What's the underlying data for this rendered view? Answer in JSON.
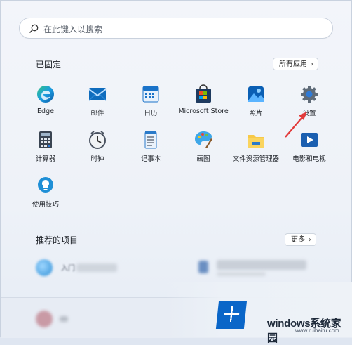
{
  "search": {
    "placeholder": "在此键入以搜索"
  },
  "pinned": {
    "title": "已固定",
    "all_apps_label": "所有应用",
    "apps": [
      {
        "label": "Edge",
        "icon": "edge-icon"
      },
      {
        "label": "邮件",
        "icon": "mail-icon"
      },
      {
        "label": "日历",
        "icon": "calendar-icon"
      },
      {
        "label": "Microsoft Store",
        "icon": "store-icon"
      },
      {
        "label": "照片",
        "icon": "photos-icon"
      },
      {
        "label": "设置",
        "icon": "settings-gear-icon"
      },
      {
        "label": "计算器",
        "icon": "calculator-icon"
      },
      {
        "label": "时钟",
        "icon": "clock-icon"
      },
      {
        "label": "记事本",
        "icon": "notepad-icon"
      },
      {
        "label": "画图",
        "icon": "paint-palette-icon"
      },
      {
        "label": "文件资源管理器",
        "icon": "folder-icon"
      },
      {
        "label": "电影和电视",
        "icon": "movies-tv-icon"
      },
      {
        "label": "使用技巧",
        "icon": "tips-bulb-icon"
      }
    ]
  },
  "recommended": {
    "title": "推荐的项目",
    "more_label": "更多",
    "items": [
      {
        "label": "入门"
      }
    ]
  },
  "watermark": {
    "text": "windows系统家园",
    "sub": "www.ruihaitu.com"
  },
  "colors": {
    "accent": "#0a66c8",
    "annotation_arrow": "#e23a3a"
  }
}
